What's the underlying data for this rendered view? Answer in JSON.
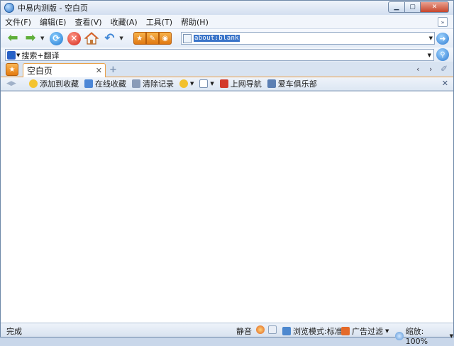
{
  "window": {
    "title": "中易内测版 - 空白页",
    "min_glyph": "▁",
    "max_glyph": "▢",
    "close_glyph": "✕"
  },
  "menu": [
    "文件(F)",
    "编辑(E)",
    "查看(V)",
    "收藏(A)",
    "工具(T)",
    "帮助(H)"
  ],
  "menu_more_glyph": "»",
  "nav": {
    "address": "about:blank"
  },
  "search": {
    "label": "搜索+翻译"
  },
  "tabs": [
    {
      "label": "空白页"
    }
  ],
  "favorites_bar": {
    "items": [
      "添加到收藏",
      "在线收藏",
      "清除记录",
      "上网导航",
      "爱车俱乐部"
    ]
  },
  "status": {
    "text": "完成",
    "mute": "静音",
    "browse_mode": "浏览模式:标准",
    "ad_filter": "广告过滤",
    "zoom": "缩放: 100%"
  },
  "colors": {
    "accent_orange": "#e47b12",
    "selection_blue": "#3a74c9",
    "frame": "#dde7f3"
  }
}
